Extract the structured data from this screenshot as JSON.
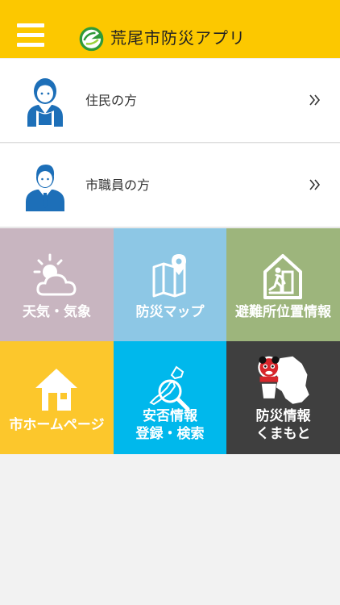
{
  "header": {
    "title": "荒尾市防災アプリ",
    "color": "#fcc800"
  },
  "rows": [
    {
      "label": "住民の方",
      "icon": "resident-icon"
    },
    {
      "label": "市職員の方",
      "icon": "staff-icon"
    }
  ],
  "tiles": [
    {
      "label": "天気・気象",
      "icon": "weather-icon",
      "color": "#c8b5c0"
    },
    {
      "label": "防災マップ",
      "icon": "map-pin-icon",
      "color": "#8dc7e5"
    },
    {
      "label": "避難所位置情報",
      "icon": "evacuation-icon",
      "color": "#9db57c"
    },
    {
      "label": "市ホームページ",
      "icon": "home-icon",
      "color": "#fcc72c"
    },
    {
      "label_line1": "安否情報",
      "label_line2": "登録・検索",
      "icon": "japan-search-icon",
      "color": "#00b8ec"
    },
    {
      "label_line1": "防災情報",
      "label_line2": "くまもと",
      "icon": "kumamon-icon",
      "color": "#3f3f3f"
    }
  ]
}
